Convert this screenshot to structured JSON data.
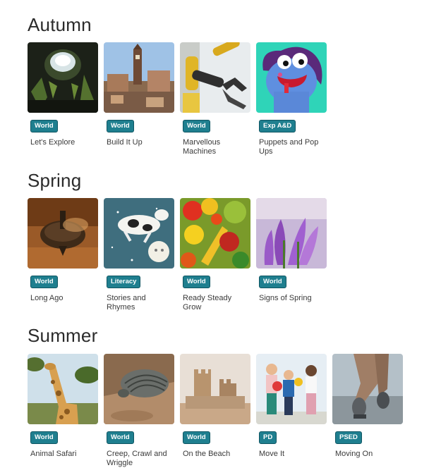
{
  "seasons": [
    {
      "title": "Autumn",
      "cards": [
        {
          "badge": "World",
          "title": "Let's Explore",
          "image": "cave-icon"
        },
        {
          "badge": "World",
          "title": "Build It Up",
          "image": "town-icon"
        },
        {
          "badge": "World",
          "title": "Marvellous Machines",
          "image": "robot-arm-icon"
        },
        {
          "badge": "Exp A&D",
          "title": "Puppets and Pop Ups",
          "image": "puppet-icon"
        }
      ]
    },
    {
      "title": "Spring",
      "cards": [
        {
          "badge": "World",
          "title": "Long Ago",
          "image": "spinning-top-icon"
        },
        {
          "badge": "Literacy",
          "title": "Stories and Rhymes",
          "image": "cow-moon-icon"
        },
        {
          "badge": "World",
          "title": "Ready Steady Grow",
          "image": "vegetables-icon"
        },
        {
          "badge": "World",
          "title": "Signs of Spring",
          "image": "crocus-icon"
        }
      ]
    },
    {
      "title": "Summer",
      "cards": [
        {
          "badge": "World",
          "title": "Animal Safari",
          "image": "giraffe-icon"
        },
        {
          "badge": "World",
          "title": "Creep, Crawl and Wriggle",
          "image": "woodlouse-icon"
        },
        {
          "badge": "World",
          "title": "On the Beach",
          "image": "sandcastle-icon"
        },
        {
          "badge": "PD",
          "title": "Move It",
          "image": "children-icon"
        },
        {
          "badge": "PSED",
          "title": "Moving On",
          "image": "walking-feet-icon"
        }
      ]
    }
  ],
  "colors": {
    "badge": "#1f7f8f",
    "badge_border": "#0e5562",
    "title": "#2b2b2b"
  }
}
